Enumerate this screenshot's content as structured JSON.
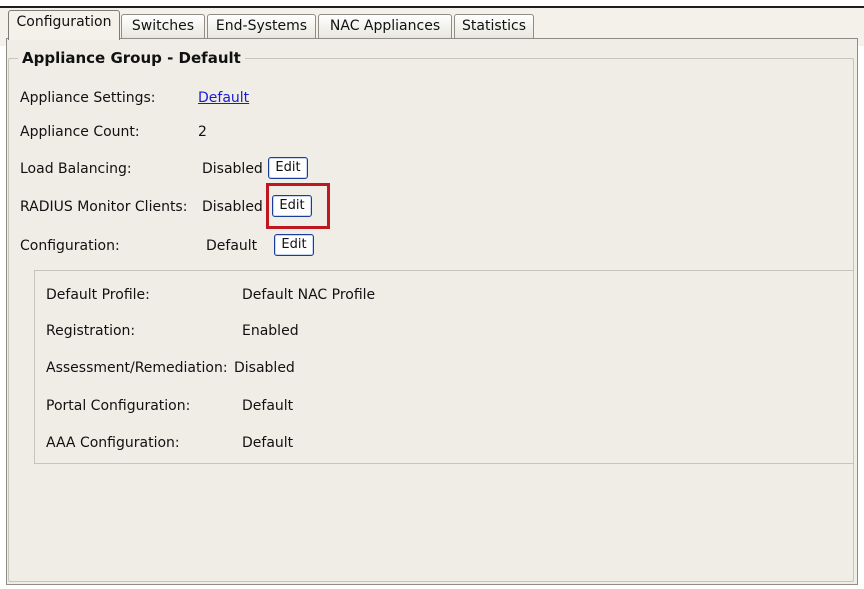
{
  "tabs": [
    "Configuration",
    "Switches",
    "End-Systems",
    "NAC Appliances",
    "Statistics"
  ],
  "group": {
    "title": "Appliance Group - Default"
  },
  "settings": {
    "appliance_settings_label": "Appliance Settings:",
    "appliance_settings_value": "Default",
    "appliance_count_label": "Appliance Count:",
    "appliance_count_value": "2",
    "load_balancing_label": "Load Balancing:",
    "load_balancing_value": "Disabled",
    "radius_label": "RADIUS Monitor Clients:",
    "radius_value": "Disabled",
    "configuration_label": "Configuration:",
    "configuration_value": "Default",
    "edit_label": "Edit"
  },
  "profile": {
    "default_profile_label": "Default Profile:",
    "default_profile_value": "Default NAC Profile",
    "registration_label": "Registration:",
    "registration_value": "Enabled",
    "assessment_label": "Assessment/Remediation:",
    "assessment_value": "Disabled",
    "portal_label": "Portal Configuration:",
    "portal_value": "Default",
    "aaa_label": "AAA Configuration:",
    "aaa_value": "Default"
  },
  "colors": {
    "highlight": "#c0161f",
    "link": "#1a1ad6",
    "button_border": "#1c3c9c"
  }
}
